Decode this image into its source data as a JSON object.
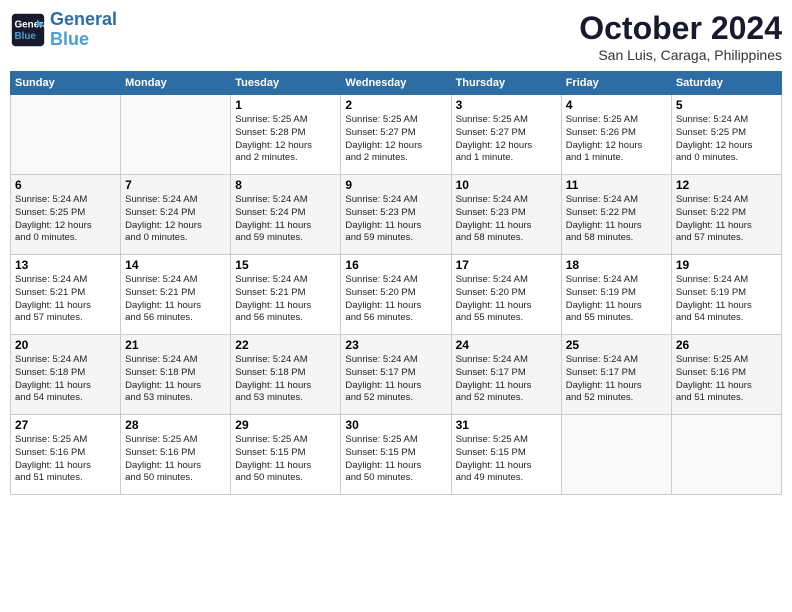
{
  "header": {
    "logo_line1": "General",
    "logo_line2": "Blue",
    "month_title": "October 2024",
    "subtitle": "San Luis, Caraga, Philippines"
  },
  "days_of_week": [
    "Sunday",
    "Monday",
    "Tuesday",
    "Wednesday",
    "Thursday",
    "Friday",
    "Saturday"
  ],
  "weeks": [
    [
      {
        "day": "",
        "detail": ""
      },
      {
        "day": "",
        "detail": ""
      },
      {
        "day": "1",
        "detail": "Sunrise: 5:25 AM\nSunset: 5:28 PM\nDaylight: 12 hours\nand 2 minutes."
      },
      {
        "day": "2",
        "detail": "Sunrise: 5:25 AM\nSunset: 5:27 PM\nDaylight: 12 hours\nand 2 minutes."
      },
      {
        "day": "3",
        "detail": "Sunrise: 5:25 AM\nSunset: 5:27 PM\nDaylight: 12 hours\nand 1 minute."
      },
      {
        "day": "4",
        "detail": "Sunrise: 5:25 AM\nSunset: 5:26 PM\nDaylight: 12 hours\nand 1 minute."
      },
      {
        "day": "5",
        "detail": "Sunrise: 5:24 AM\nSunset: 5:25 PM\nDaylight: 12 hours\nand 0 minutes."
      }
    ],
    [
      {
        "day": "6",
        "detail": "Sunrise: 5:24 AM\nSunset: 5:25 PM\nDaylight: 12 hours\nand 0 minutes."
      },
      {
        "day": "7",
        "detail": "Sunrise: 5:24 AM\nSunset: 5:24 PM\nDaylight: 12 hours\nand 0 minutes."
      },
      {
        "day": "8",
        "detail": "Sunrise: 5:24 AM\nSunset: 5:24 PM\nDaylight: 11 hours\nand 59 minutes."
      },
      {
        "day": "9",
        "detail": "Sunrise: 5:24 AM\nSunset: 5:23 PM\nDaylight: 11 hours\nand 59 minutes."
      },
      {
        "day": "10",
        "detail": "Sunrise: 5:24 AM\nSunset: 5:23 PM\nDaylight: 11 hours\nand 58 minutes."
      },
      {
        "day": "11",
        "detail": "Sunrise: 5:24 AM\nSunset: 5:22 PM\nDaylight: 11 hours\nand 58 minutes."
      },
      {
        "day": "12",
        "detail": "Sunrise: 5:24 AM\nSunset: 5:22 PM\nDaylight: 11 hours\nand 57 minutes."
      }
    ],
    [
      {
        "day": "13",
        "detail": "Sunrise: 5:24 AM\nSunset: 5:21 PM\nDaylight: 11 hours\nand 57 minutes."
      },
      {
        "day": "14",
        "detail": "Sunrise: 5:24 AM\nSunset: 5:21 PM\nDaylight: 11 hours\nand 56 minutes."
      },
      {
        "day": "15",
        "detail": "Sunrise: 5:24 AM\nSunset: 5:21 PM\nDaylight: 11 hours\nand 56 minutes."
      },
      {
        "day": "16",
        "detail": "Sunrise: 5:24 AM\nSunset: 5:20 PM\nDaylight: 11 hours\nand 56 minutes."
      },
      {
        "day": "17",
        "detail": "Sunrise: 5:24 AM\nSunset: 5:20 PM\nDaylight: 11 hours\nand 55 minutes."
      },
      {
        "day": "18",
        "detail": "Sunrise: 5:24 AM\nSunset: 5:19 PM\nDaylight: 11 hours\nand 55 minutes."
      },
      {
        "day": "19",
        "detail": "Sunrise: 5:24 AM\nSunset: 5:19 PM\nDaylight: 11 hours\nand 54 minutes."
      }
    ],
    [
      {
        "day": "20",
        "detail": "Sunrise: 5:24 AM\nSunset: 5:18 PM\nDaylight: 11 hours\nand 54 minutes."
      },
      {
        "day": "21",
        "detail": "Sunrise: 5:24 AM\nSunset: 5:18 PM\nDaylight: 11 hours\nand 53 minutes."
      },
      {
        "day": "22",
        "detail": "Sunrise: 5:24 AM\nSunset: 5:18 PM\nDaylight: 11 hours\nand 53 minutes."
      },
      {
        "day": "23",
        "detail": "Sunrise: 5:24 AM\nSunset: 5:17 PM\nDaylight: 11 hours\nand 52 minutes."
      },
      {
        "day": "24",
        "detail": "Sunrise: 5:24 AM\nSunset: 5:17 PM\nDaylight: 11 hours\nand 52 minutes."
      },
      {
        "day": "25",
        "detail": "Sunrise: 5:24 AM\nSunset: 5:17 PM\nDaylight: 11 hours\nand 52 minutes."
      },
      {
        "day": "26",
        "detail": "Sunrise: 5:25 AM\nSunset: 5:16 PM\nDaylight: 11 hours\nand 51 minutes."
      }
    ],
    [
      {
        "day": "27",
        "detail": "Sunrise: 5:25 AM\nSunset: 5:16 PM\nDaylight: 11 hours\nand 51 minutes."
      },
      {
        "day": "28",
        "detail": "Sunrise: 5:25 AM\nSunset: 5:16 PM\nDaylight: 11 hours\nand 50 minutes."
      },
      {
        "day": "29",
        "detail": "Sunrise: 5:25 AM\nSunset: 5:15 PM\nDaylight: 11 hours\nand 50 minutes."
      },
      {
        "day": "30",
        "detail": "Sunrise: 5:25 AM\nSunset: 5:15 PM\nDaylight: 11 hours\nand 50 minutes."
      },
      {
        "day": "31",
        "detail": "Sunrise: 5:25 AM\nSunset: 5:15 PM\nDaylight: 11 hours\nand 49 minutes."
      },
      {
        "day": "",
        "detail": ""
      },
      {
        "day": "",
        "detail": ""
      }
    ]
  ]
}
